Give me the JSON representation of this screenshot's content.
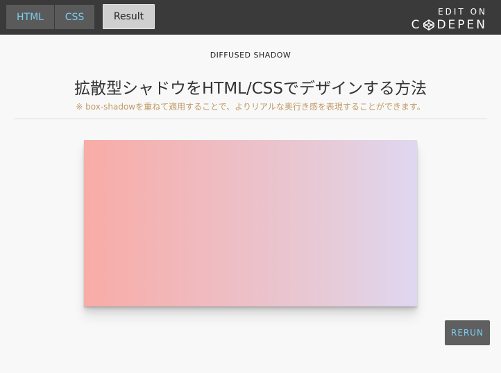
{
  "toolbar": {
    "tabs": [
      {
        "label": "HTML"
      },
      {
        "label": "CSS"
      }
    ],
    "result_label": "Result",
    "edit_on": "EDIT ON",
    "codepen_prefix": "C",
    "codepen_suffix": "DEPEN"
  },
  "content": {
    "subtitle": "DIFFUSED SHADOW",
    "title": "拡散型シャドウをHTML/CSSでデザインする方法",
    "note": "※ box-shadowを重ねて適用することで、よりリアルな奥行き感を表現することができます。"
  },
  "rerun_label": "RERUN",
  "colors": {
    "topbar": "#3a3a3a",
    "tab_text": "#7ccff3",
    "note_text": "#c29a66",
    "gradient_start": "#f8aca6",
    "gradient_end": "#dfd7f1"
  }
}
